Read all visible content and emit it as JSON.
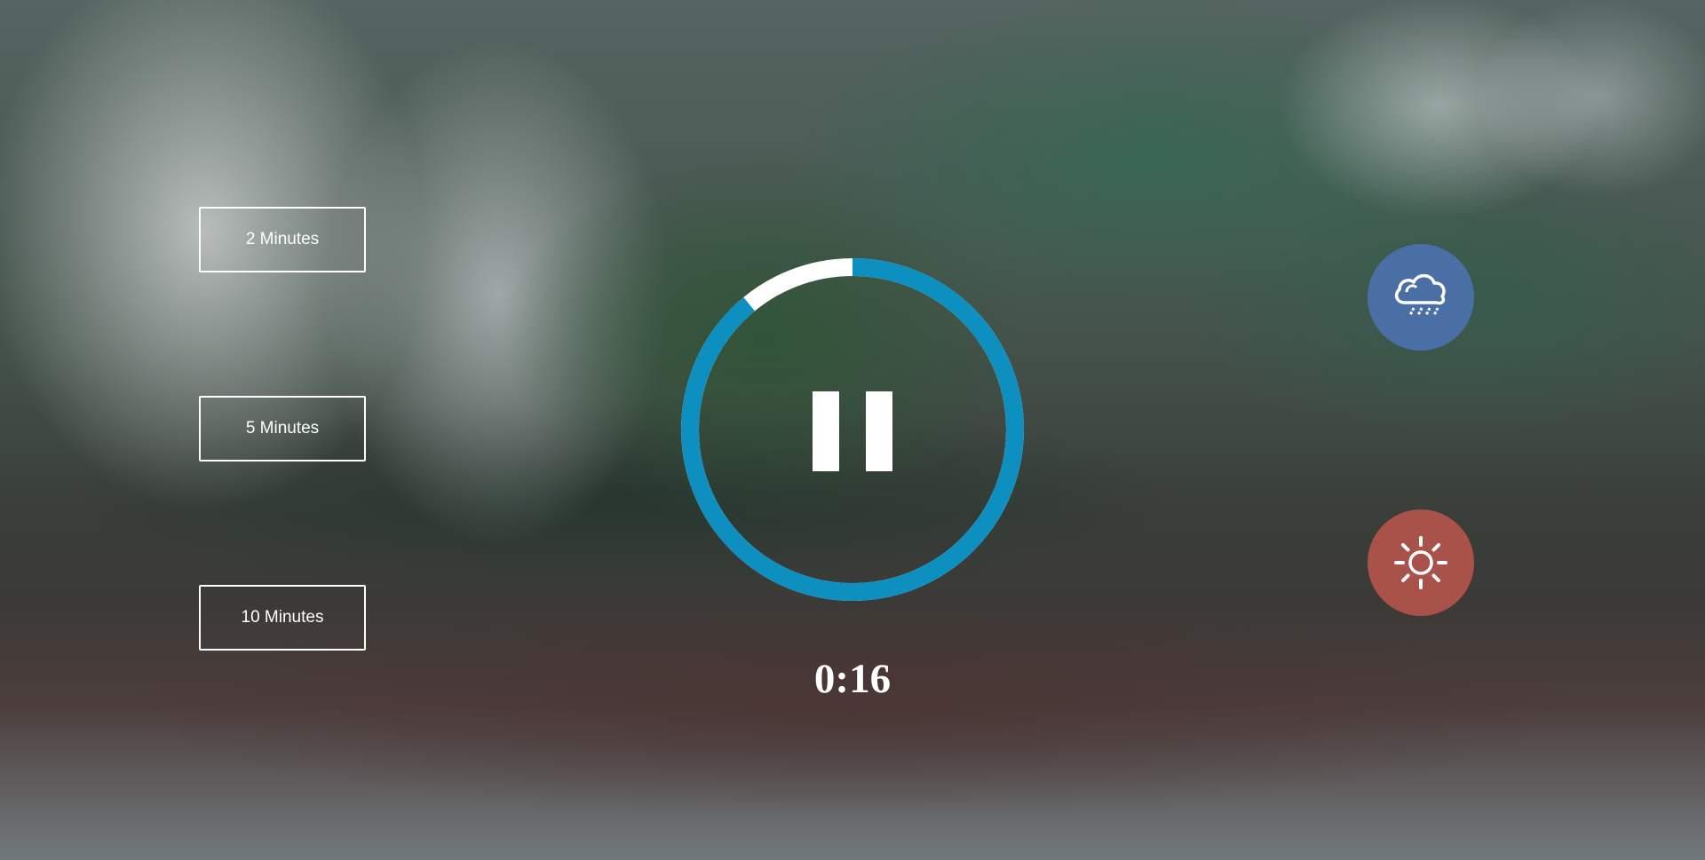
{
  "durations": {
    "two": "2 Minutes",
    "five": "5 Minutes",
    "ten": "10 Minutes"
  },
  "player": {
    "state": "playing",
    "progress": 0.89,
    "track_color": "#ffffff",
    "progress_color": "#0d8fbf"
  },
  "timer": {
    "display": "0:16"
  },
  "sounds": [
    {
      "name": "rain",
      "icon": "cloud-rain-icon",
      "color": "#4a6fa5"
    },
    {
      "name": "summer",
      "icon": "sun-icon",
      "color": "#a8524a"
    }
  ]
}
